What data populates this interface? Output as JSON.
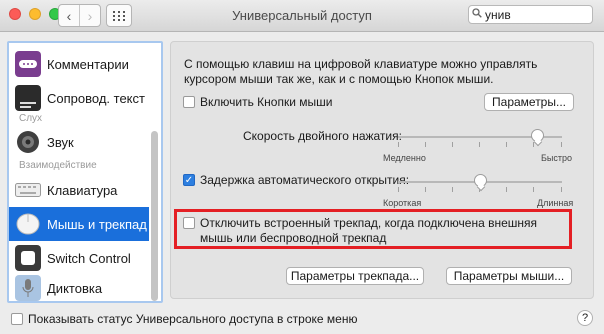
{
  "window": {
    "title": "Универсальный доступ"
  },
  "toolbar": {
    "back_icon": "chevron-left-icon",
    "forward_icon": "chevron-right-icon",
    "grid_icon": "grid-icon"
  },
  "search": {
    "value": "унив",
    "icon": "search-icon"
  },
  "sidebar": {
    "items": [
      {
        "label": "Комментарии",
        "icon": "comments-icon",
        "color": "#7a3d8f"
      },
      {
        "label": "Сопровод. текст",
        "icon": "captions-icon",
        "color": "#2b2b2b"
      },
      {
        "label": "Звук",
        "icon": "speaker-icon",
        "color": "#4d4d4d"
      },
      {
        "label": "Клавиатура",
        "icon": "keyboard-icon",
        "color": "#d8d8d8"
      },
      {
        "label": "Мышь и трекпад",
        "icon": "mouse-icon",
        "color": "#f4f4f4",
        "selected": true
      },
      {
        "label": "Switch Control",
        "icon": "switch-control-icon",
        "color": "#3a3a3a"
      },
      {
        "label": "Диктовка",
        "icon": "microphone-icon",
        "color": "#a9c4e2"
      }
    ],
    "headers": {
      "hearing": "Слух",
      "interaction": "Взаимодействие"
    }
  },
  "panel": {
    "intro": "С помощью клавиш на цифровой клавиатуре можно управлять курсором мыши так же, как и с помощью Кнопок мыши.",
    "mouse_keys_label": "Включить Кнопки мыши",
    "mouse_keys_checked": false,
    "options_button": "Параметры...",
    "double_click_label": "Скорость двойного нажатия:",
    "double_click_min": "Медленно",
    "double_click_max": "Быстро",
    "double_click_value": 0.85,
    "spring_delay_label": "Задержка автоматического открытия:",
    "spring_delay_checked": true,
    "spring_delay_min": "Короткая",
    "spring_delay_max": "Длинная",
    "spring_delay_value": 0.5,
    "ignore_trackpad_label": "Отключить встроенный трекпад, когда подключена внешняя мышь или беспроводной трекпад",
    "ignore_trackpad_checked": false,
    "trackpad_options_button": "Параметры трекпада...",
    "mouse_options_button": "Параметры мыши..."
  },
  "footer": {
    "show_status_label": "Показывать статус Универсального доступа в строке меню",
    "show_status_checked": false,
    "help": "?"
  },
  "colors": {
    "accent": "#1a6fdb",
    "highlight": "#e41f24"
  }
}
